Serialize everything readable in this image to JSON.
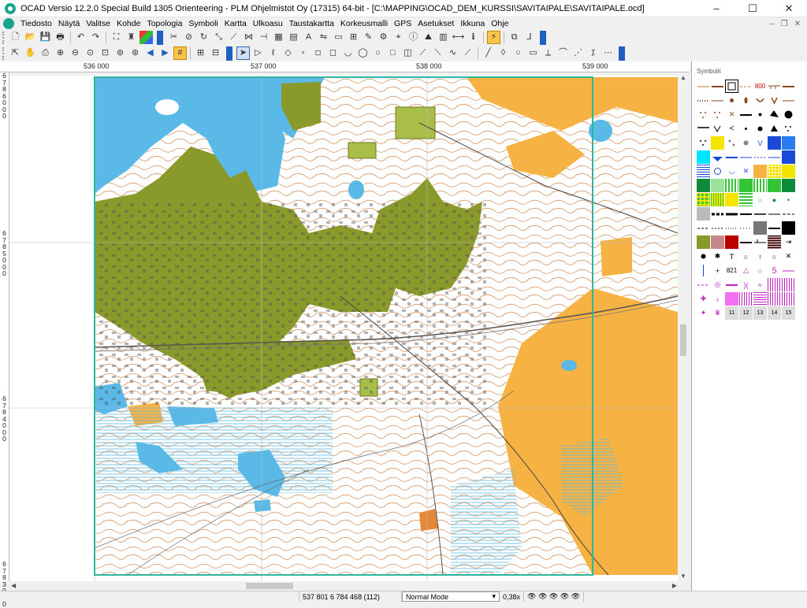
{
  "window": {
    "title": "OCAD Versio 12.2.0  Special Build 1305  Orienteering - PLM Ohjelmistot Oy (17315) 64-bit - [C:\\MAPPING\\OCAD_DEM_KURSSI\\SAVITAIPALE\\SAVITAIPALE.ocd]",
    "minimize": "–",
    "maximize": "☐",
    "close": "✕"
  },
  "menu": [
    {
      "label": "Tiedosto"
    },
    {
      "label": "Näytä"
    },
    {
      "label": "Valitse"
    },
    {
      "label": "Kohde"
    },
    {
      "label": "Topologia"
    },
    {
      "label": "Symboli"
    },
    {
      "label": "Kartta"
    },
    {
      "label": "Ulkoasu"
    },
    {
      "label": "Taustakartta"
    },
    {
      "label": "Korkeusmalli"
    },
    {
      "label": "GPS"
    },
    {
      "label": "Asetukset"
    },
    {
      "label": "Ikkuna"
    },
    {
      "label": "Ohje"
    }
  ],
  "mdi_controls": {
    "minimize": "–",
    "restore": "❐",
    "close": "✕"
  },
  "toolbar1_icons": [
    "new-icon",
    "open-icon",
    "save-icon",
    "print-icon",
    "undo-icon",
    "redo-icon",
    "fullscreen-icon",
    "symbol-editor-icon",
    "color-icon",
    "cut-icon",
    "delete-icon",
    "rotate-icon",
    "stretch-icon",
    "reshape-icon",
    "join-icon",
    "cut-line-icon",
    "fill-icon",
    "background-icon",
    "text-icon",
    "mirror-icon",
    "area-icon",
    "merge-icon",
    "edit-icon",
    "settings-icon",
    "gps-icon",
    "info-icon",
    "dem-icon",
    "hatch-icon",
    "snap-icon"
  ],
  "toolbar2_icons": [
    "hand-icon",
    "zoom-in-icon",
    "zoom-out-icon",
    "zoom-fit-icon",
    "zoom-rect-icon",
    "zoom-prev-icon",
    "zoom-next-icon",
    "back-icon",
    "forward-icon",
    "grid-icon",
    "draft-icon",
    "scale-icon",
    "pointer-icon",
    "select-icon",
    "lasso-icon",
    "node-icon",
    "square-icon",
    "corner-icon",
    "dash-icon",
    "curve-icon",
    "ellipse-icon",
    "circle-icon",
    "rect-icon",
    "line-icon",
    "freehand-icon",
    "straight-icon",
    "measure-icon",
    "more-icon"
  ],
  "ruler": {
    "x_labels": [
      "536 000",
      "537 000",
      "538 000",
      "539 000"
    ],
    "y_labels": [
      "6786000",
      "6785000",
      "6784000",
      "6783000"
    ]
  },
  "symbols_panel": {
    "title": "Symbolit",
    "symbol_label_800": "800",
    "symbol_label_821": "821",
    "symbol_label_5": "5",
    "symbol_numbers": [
      "11",
      "12",
      "13",
      "14",
      "15"
    ]
  },
  "status": {
    "coords": "537 801   6 784 468  (112)",
    "mode": "Normal Mode",
    "zoom": "0,38x"
  },
  "colors": {
    "water": "#5ab9e6",
    "green": "#8a9a2a",
    "open_yellow": "#f6b243",
    "contour": "#c8783a",
    "frame": "#2db5a0"
  }
}
